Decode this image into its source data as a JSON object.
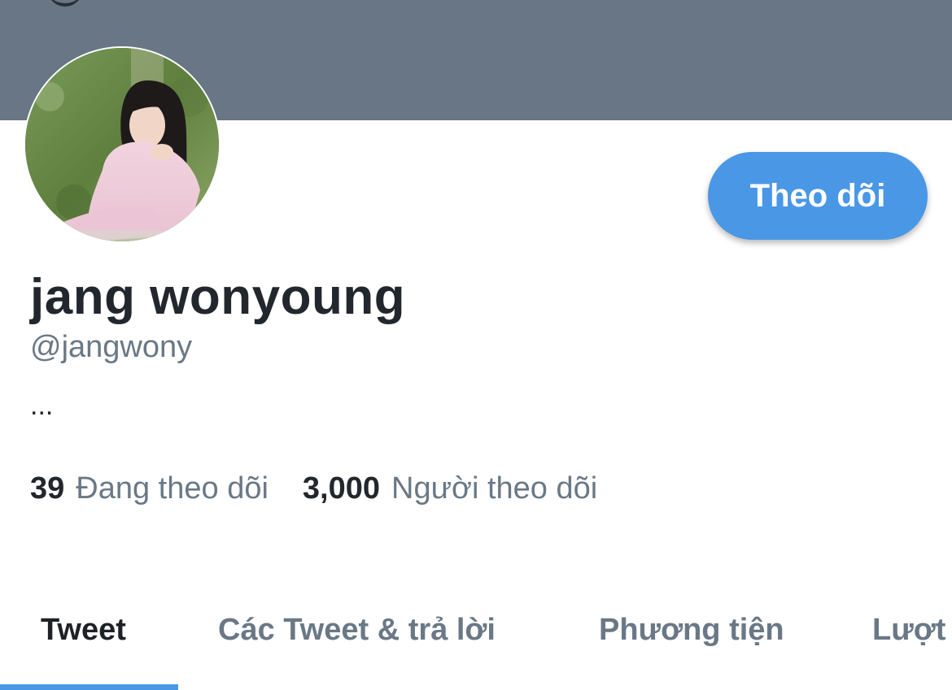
{
  "profile": {
    "display_name": "jang wonyoung",
    "handle": "@jangwony",
    "bio": "...",
    "follow_button_label": "Theo dõi"
  },
  "stats": {
    "following_count": "39",
    "following_label": "Đang theo dõi",
    "followers_count": "3,000",
    "followers_label": "Người theo dõi"
  },
  "tabs": [
    {
      "label": "Tweet",
      "active": true
    },
    {
      "label": "Các Tweet & trả lời",
      "active": false
    },
    {
      "label": "Phương tiện",
      "active": false
    },
    {
      "label": "Lượt",
      "active": false
    }
  ],
  "colors": {
    "banner": "#687685",
    "accent": "#4a97e6",
    "primary_text": "#22272d",
    "secondary_text": "#6a7886"
  }
}
